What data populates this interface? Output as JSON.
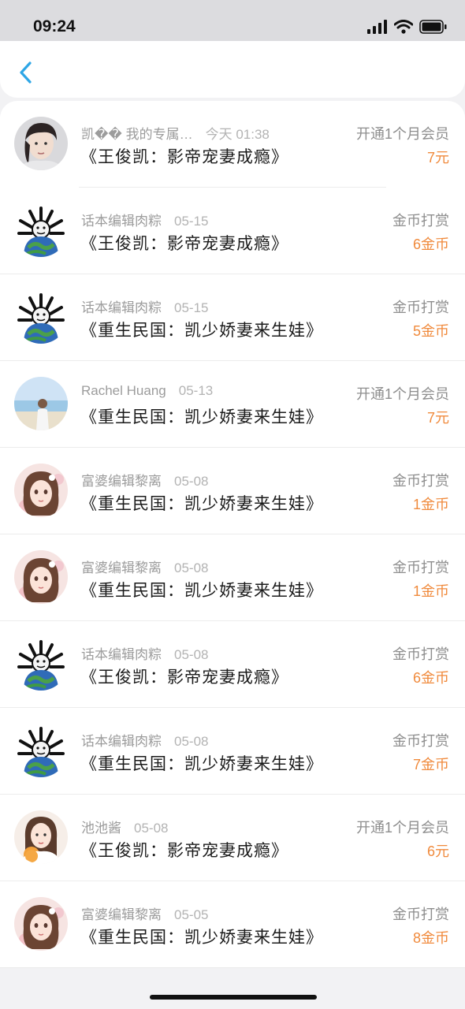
{
  "status": {
    "time": "09:24"
  },
  "colors": {
    "accent": "#2ea6e6",
    "amount": "#f08a3c"
  },
  "nav": {
    "back_icon": "chevron-left-icon"
  },
  "records": [
    {
      "user": "凯�� 我的专属…",
      "date": "今天 01:38",
      "book": "《王俊凯：影帝宠妻成瘾》",
      "type": "开通1个月会员",
      "amount": "7元",
      "avatar": "photo"
    },
    {
      "user": "话本编辑肉粽",
      "date": "05-15",
      "book": "《王俊凯：影帝宠妻成瘾》",
      "type": "金币打赏",
      "amount": "6金币",
      "avatar": "meme"
    },
    {
      "user": "话本编辑肉粽",
      "date": "05-15",
      "book": "《重生民国：凯少娇妻来生娃》",
      "type": "金币打赏",
      "amount": "5金币",
      "avatar": "meme"
    },
    {
      "user": "Rachel Huang",
      "date": "05-13",
      "book": "《重生民国：凯少娇妻来生娃》",
      "type": "开通1个月会员",
      "amount": "7元",
      "avatar": "beach"
    },
    {
      "user": "富婆编辑黎离",
      "date": "05-08",
      "book": "《重生民国：凯少娇妻来生娃》",
      "type": "金币打赏",
      "amount": "1金币",
      "avatar": "anime"
    },
    {
      "user": "富婆编辑黎离",
      "date": "05-08",
      "book": "《重生民国：凯少娇妻来生娃》",
      "type": "金币打赏",
      "amount": "1金币",
      "avatar": "anime"
    },
    {
      "user": "话本编辑肉粽",
      "date": "05-08",
      "book": "《王俊凯：影帝宠妻成瘾》",
      "type": "金币打赏",
      "amount": "6金币",
      "avatar": "meme"
    },
    {
      "user": "话本编辑肉粽",
      "date": "05-08",
      "book": "《重生民国：凯少娇妻来生娃》",
      "type": "金币打赏",
      "amount": "7金币",
      "avatar": "meme"
    },
    {
      "user": "池池酱",
      "date": "05-08",
      "book": "《王俊凯：影帝宠妻成瘾》",
      "type": "开通1个月会员",
      "amount": "6元",
      "avatar": "girl"
    },
    {
      "user": "富婆编辑黎离",
      "date": "05-05",
      "book": "《重生民国：凯少娇妻来生娃》",
      "type": "金币打赏",
      "amount": "8金币",
      "avatar": "anime"
    }
  ]
}
